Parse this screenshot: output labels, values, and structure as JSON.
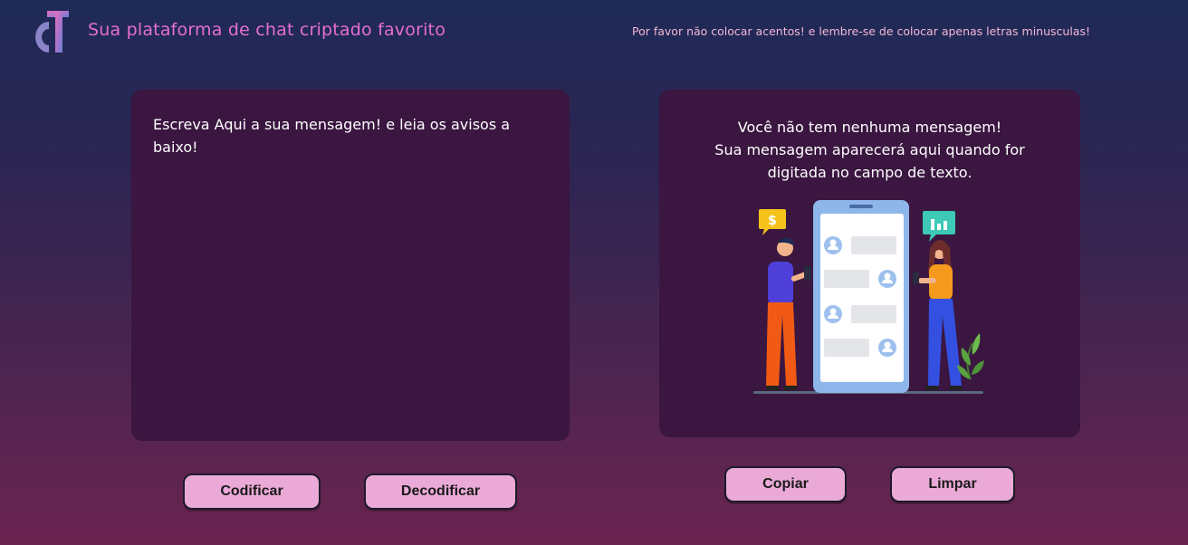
{
  "header": {
    "logo_icon": "ct-logo",
    "title": "Sua plataforma de chat criptado favorito",
    "warning": "Por favor não colocar acentos! e lembre-se de colocar apenas letras minusculas!"
  },
  "input_panel": {
    "placeholder": "Escreva Aqui a sua mensagem! e leia os avisos a baixo!",
    "value": ""
  },
  "output_panel": {
    "empty_line_1": "Você não tem nenhuma mensagem!",
    "empty_line_2": "Sua mensagem aparecerá aqui quando for",
    "empty_line_3": "digitada no campo de texto.",
    "illustration_icon": "people-chatting-illustration"
  },
  "actions": {
    "encode_label": "Codificar",
    "decode_label": "Decodificar",
    "copy_label": "Copiar",
    "clear_label": "Limpar"
  },
  "colors": {
    "accent": "#e46fd0",
    "button": "#eaa9d6",
    "panel": "#3a1640"
  }
}
